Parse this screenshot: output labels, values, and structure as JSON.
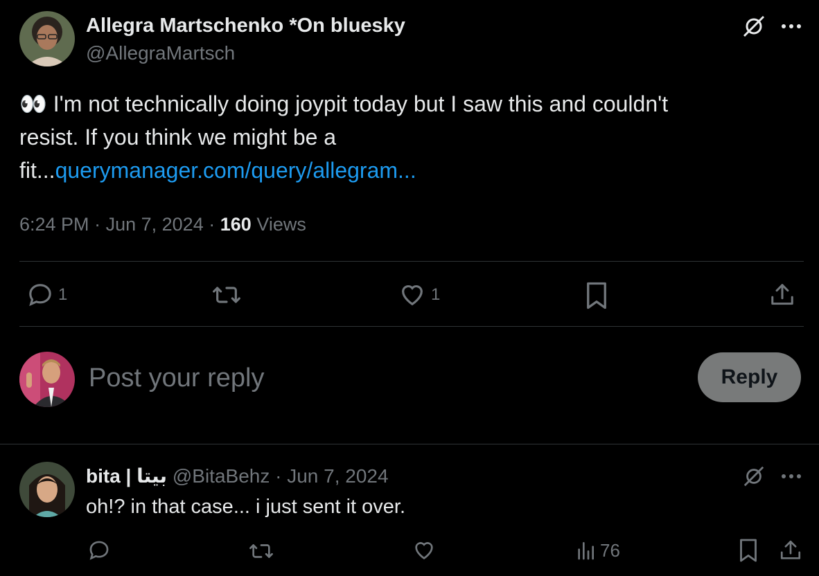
{
  "tweet": {
    "author_name": "Allegra Martschenko *On bluesky",
    "author_handle": "@AllegraMartsch",
    "emoji": "👀",
    "text_line1": " I'm not technically doing joypit today but I saw this and couldn't",
    "text_line2": "resist. If you think we might be a",
    "text_line3_prefix": "fit...",
    "link_text": "querymanager.com/query/allegram...",
    "time": "6:24 PM",
    "date": "Jun 7, 2024",
    "views_count": "160",
    "views_label": "Views",
    "reply_count": "1",
    "like_count": "1"
  },
  "composer": {
    "placeholder": "Post your reply",
    "button_label": "Reply"
  },
  "reply": {
    "author_name": "bita | بیتا",
    "author_handle": "@BitaBehz",
    "separator": "·",
    "date": "Jun 7, 2024",
    "text": "oh!? in that case... i just sent it over.",
    "views_count": "76"
  },
  "icons": {
    "grok": "grok-slash-icon",
    "more": "more-dots-icon",
    "reply": "reply-bubble-icon",
    "repost": "repost-icon",
    "like": "heart-icon",
    "bookmark": "bookmark-icon",
    "share": "share-upload-icon",
    "views": "views-bar-icon"
  },
  "colors": {
    "background": "#000000",
    "text": "#e7e9ea",
    "muted": "#71767b",
    "link": "#1d9bf0",
    "divider": "#2f3336",
    "reply_button": "#787a7a"
  }
}
